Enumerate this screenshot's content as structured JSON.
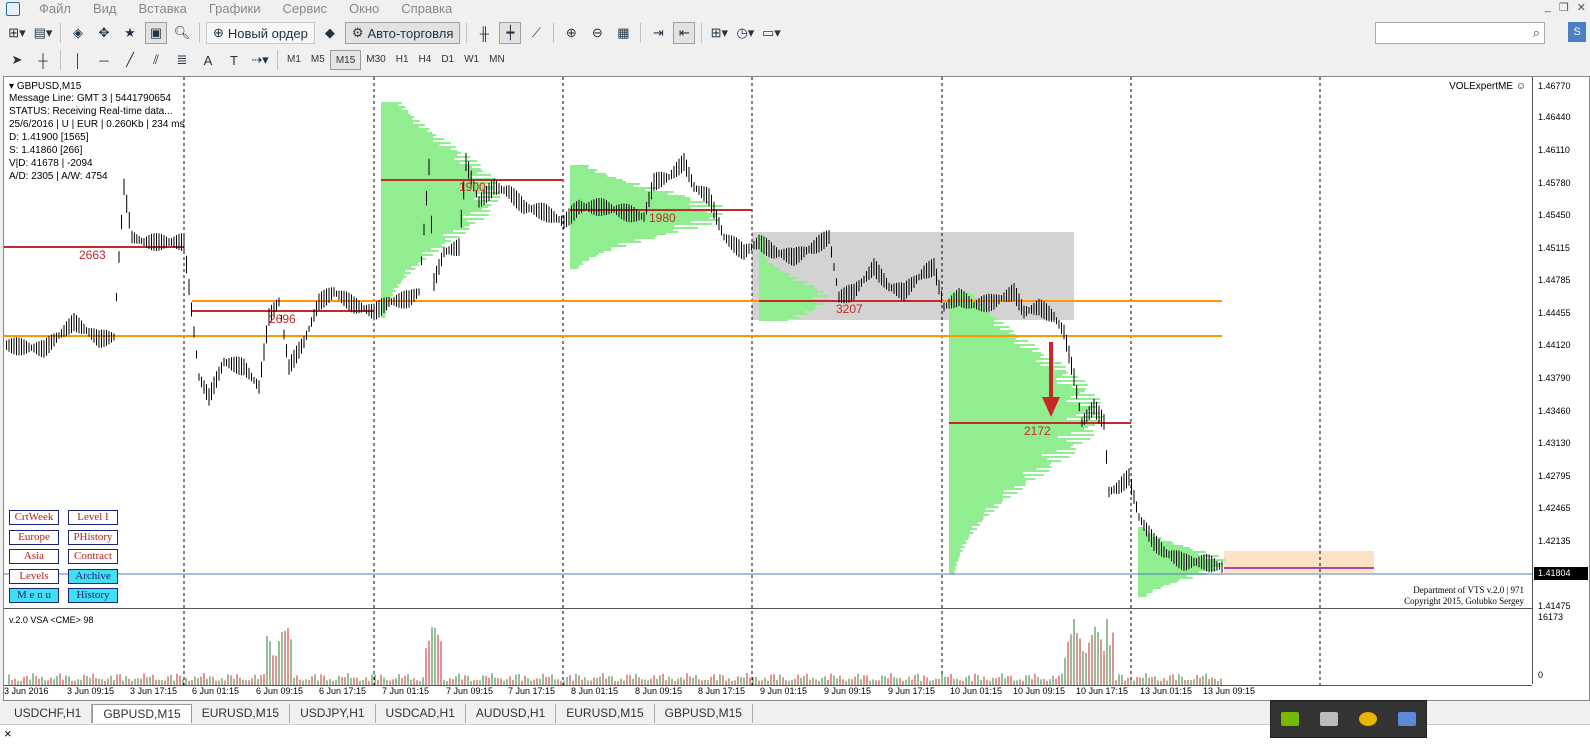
{
  "menubar": {
    "items": [
      "Файл",
      "Вид",
      "Вставка",
      "Графики",
      "Сервис",
      "Окно",
      "Справка"
    ]
  },
  "toolbar": {
    "new_order": "Новый ордер",
    "auto_trading": "Авто-торговля"
  },
  "timeframes": [
    "M1",
    "M5",
    "M15",
    "M30",
    "H1",
    "H4",
    "D1",
    "W1",
    "MN"
  ],
  "active_timeframe": "M15",
  "chart": {
    "symbol": "GBPUSD,M15",
    "info": [
      "Message Line: GMT 3 | 5441790654",
      "STATUS:  Receiving Real-time data...",
      "25/6/2016 | U | EUR | 0.260Kb | 234 ms",
      "D: 1.41900  [1565]",
      "S: 1.41860  [266]",
      "V|D: 41678 | -2094",
      "A/D: 2305 | A/W: 4754"
    ],
    "expert": "VOLExpertME ☺",
    "copyright": [
      "Department of VTS  v.2.0 | 971",
      "Copyright 2015, Golubko Sergey"
    ],
    "current_price": "1.41804",
    "price_levels": [
      "1.46770",
      "1.46440",
      "1.46110",
      "1.45780",
      "1.45450",
      "1.45115",
      "1.44785",
      "1.44455",
      "1.44120",
      "1.43790",
      "1.43460",
      "1.43130",
      "1.42795",
      "1.42465",
      "1.42135",
      "1.41475"
    ],
    "time_labels": [
      "3 Jun 2016",
      "3 Jun 09:15",
      "3 Jun 17:15",
      "6 Jun 01:15",
      "6 Jun 09:15",
      "6 Jun 17:15",
      "7 Jun 01:15",
      "7 Jun 09:15",
      "7 Jun 17:15",
      "8 Jun 01:15",
      "8 Jun 09:15",
      "8 Jun 17:15",
      "9 Jun 01:15",
      "9 Jun 09:15",
      "9 Jun 17:15",
      "10 Jun 01:15",
      "10 Jun 09:15",
      "10 Jun 17:15",
      "13 Jun 01:15",
      "13 Jun 09:15"
    ],
    "profile_labels": [
      "2663",
      "2696",
      "1900",
      "1980",
      "3207",
      "2172"
    ],
    "indicator_title": "v.2.0 VSA <CME> 98",
    "indicator_max": "16173",
    "indicator_min": "0",
    "buttons": [
      {
        "left": "CrtWeek",
        "right": "Level I"
      },
      {
        "left": "Europe",
        "right": "PHistory"
      },
      {
        "left": "Asia",
        "right": "Contract"
      },
      {
        "left": "Levels",
        "right": "Archive"
      },
      {
        "left": "M e n u",
        "right": "History"
      }
    ]
  },
  "tabs": [
    "USDCHF,H1",
    "GBPUSD,M15",
    "EURUSD,M15",
    "USDJPY,H1",
    "USDCAD,H1",
    "AUDUSD,H1",
    "EURUSD,M15",
    "GBPUSD,M15"
  ],
  "active_tab": 1,
  "colors": {
    "up_volume": "#2e7d32",
    "down_volume": "#c62828",
    "profile": "#90ee90",
    "poc_line": "#c62828",
    "level_line": "#ff9800"
  }
}
